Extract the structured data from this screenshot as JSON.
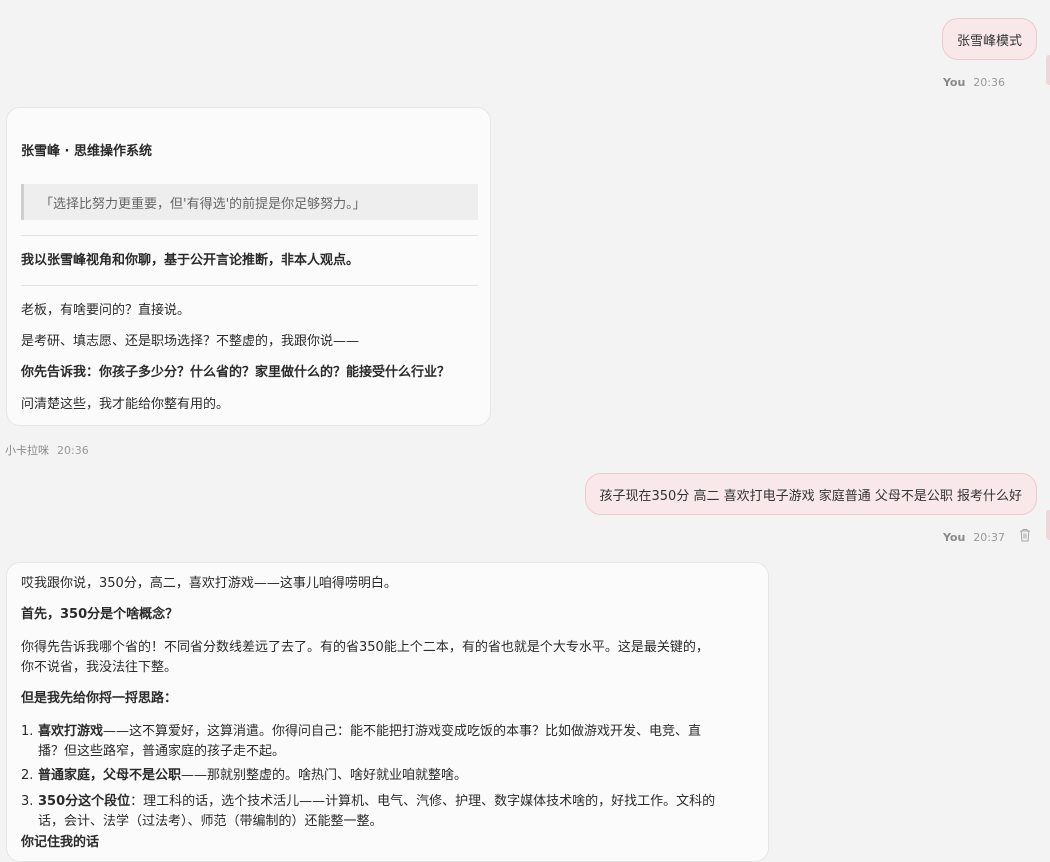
{
  "messages": [
    {
      "id": "m1",
      "role": "user",
      "text": "张雪峰模式",
      "sender": "You",
      "time": "20:36"
    },
    {
      "id": "m2",
      "role": "assistant",
      "sender": "小卡拉咪",
      "time": "20:36",
      "title": "张雪峰 · 思维操作系统",
      "quote": "「选择比努力更重要，但'有得选'的前提是你足够努力。」",
      "disclaimer": "我以张雪峰视角和你聊，基于公开言论推断，非本人观点。",
      "lines": [
        "老板，有啥要问的？直接说。",
        "是考研、填志愿、还是职场选择？不整虚的，我跟你说——",
        "你先告诉我：你孩子多少分？什么省的？家里做什么的？能接受什么行业？",
        "问清楚这些，我才能给你整有用的。"
      ]
    },
    {
      "id": "m3",
      "role": "user",
      "text": "孩子现在350分 高二 喜欢打电子游戏 家庭普通 父母不是公职 报考什么好",
      "sender": "You",
      "time": "20:37"
    },
    {
      "id": "m4",
      "role": "assistant",
      "intro": "哎我跟你说，350分，高二，喜欢打游戏——这事儿咱得唠明白。",
      "heading1": "首先，350分是个啥概念？",
      "para1_line1": "你得先告诉我哪个省的！不同省分数线差远了去了。有的省350能上个二本，有的省也就是个大专水平。这是最关键的，",
      "para1_line2": "你不说省，我没法往下整。",
      "heading2": "但是我先给你捋一捋思路：",
      "items": [
        {
          "num": "1.",
          "bold": "喜欢打游戏",
          "text_line1": "——这不算爱好，这算消遣。你得问自己：能不能把打游戏变成吃饭的本事？比如做游戏开发、电竞、直",
          "text_line2": "播？但这些路窄，普通家庭的孩子走不起。"
        },
        {
          "num": "2.",
          "bold": "普通家庭，父母不是公职",
          "text_line1": "——那就别整虚的。啥热门、啥好就业咱就整啥。",
          "text_line2": ""
        },
        {
          "num": "3.",
          "bold": "350分这个段位",
          "text_line1": "：理工科的话，选个技术活儿——计算机、电气、汽修、护理、数字媒体技术啥的，好找工作。文科的",
          "text_line2": "话，会计、法学（过法考）、师范（带编制的）还能整一整。"
        }
      ],
      "cut_off": "你记住我的话"
    }
  ]
}
